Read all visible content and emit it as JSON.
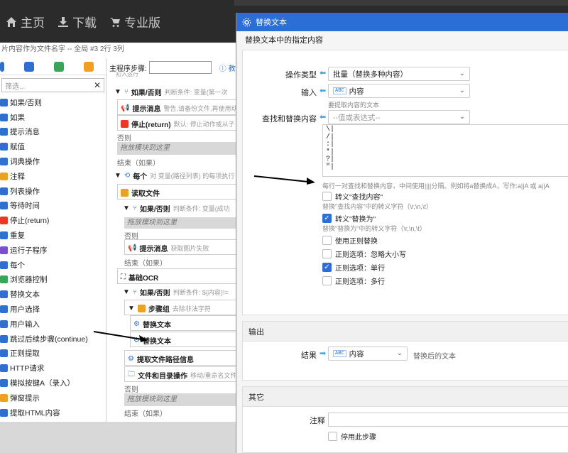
{
  "topnav": {
    "home": "主页",
    "download": "下载",
    "pro": "专业版"
  },
  "subtitle": "片内容作为文件名字 -- 全局 #3 2行 3列",
  "leftpanel": {
    "search_placeholder": "筛选...",
    "items": [
      {
        "label": "如果/否则",
        "icon": "branch-icon",
        "color": "#2f6fd0"
      },
      {
        "label": "如果",
        "icon": "branch-icon",
        "color": "#2f6fd0"
      },
      {
        "label": "提示消息",
        "icon": "megaphone-icon",
        "color": "#2f6fd0"
      },
      {
        "label": "赋值",
        "icon": "pencil-icon",
        "color": "#2f6fd0"
      },
      {
        "label": "词典操作",
        "icon": "book-icon",
        "color": "#2f6fd0"
      },
      {
        "label": "注释",
        "icon": "note-icon",
        "color": "#f0a020"
      },
      {
        "label": "列表操作",
        "icon": "list-icon",
        "color": "#2f6fd0"
      },
      {
        "label": "等待时间",
        "icon": "clock-icon",
        "color": "#2f6fd0"
      },
      {
        "label": "停止(return)",
        "icon": "stop-icon",
        "color": "#e83a1f"
      },
      {
        "label": "重复",
        "icon": "repeat-icon",
        "color": "#2f6fd0"
      },
      {
        "label": "运行子程序",
        "icon": "subroutine-icon",
        "color": "#7b4fd0"
      },
      {
        "label": "每个",
        "icon": "loop-icon",
        "color": "#2f6fd0"
      },
      {
        "label": "浏览器控制",
        "icon": "browser-icon",
        "color": "#3aa55a"
      },
      {
        "label": "替换文本",
        "icon": "gear-icon",
        "color": "#2f6fd0"
      },
      {
        "label": "用户选择",
        "icon": "user-icon",
        "color": "#2f6fd0"
      },
      {
        "label": "用户输入",
        "icon": "user-icon",
        "color": "#2f6fd0"
      },
      {
        "label": "跳过后续步骤(continue)",
        "icon": "skip-icon",
        "color": "#2f6fd0"
      },
      {
        "label": "正则提取",
        "icon": "gear-icon",
        "color": "#2f6fd0"
      },
      {
        "label": "HTTP请求",
        "icon": "gear-icon",
        "color": "#2f6fd0"
      },
      {
        "label": "模拟按键A（录入）",
        "icon": "gear-icon",
        "color": "#2f6fd0"
      },
      {
        "label": "弹窗提示",
        "icon": "popup-icon",
        "color": "#f0a020"
      },
      {
        "label": "提取HTML内容",
        "icon": "html-icon",
        "color": "#2f6fd0"
      }
    ]
  },
  "flow": {
    "main_label": "主程序步骤:",
    "help_label": "教",
    "truncated_top": "初入运行",
    "if_else_1": {
      "title": "如果/否则",
      "cond": "判断条件: 变量(第一次"
    },
    "prompt_1": {
      "title": "提示消息",
      "desc": "警告,请备份文件,再使用动作"
    },
    "stop_1": {
      "title": "停止(return)",
      "desc": "默认: 停止动作或从子"
    },
    "else_1": "否则",
    "drag_here_1": "拖放模块到这里",
    "end_1": "结束（如果）",
    "foreach": {
      "title": "每个",
      "desc": "对 变量(路径列表) 的每项执行"
    },
    "read_file": "读取文件",
    "if_else_2": {
      "title": "如果/否则",
      "cond": "判断条件: 变量(成功"
    },
    "drag_here_2": "拖放模块到这里",
    "else_2": "否则",
    "prompt_2": {
      "title": "提示消息",
      "desc": "获取图片失败"
    },
    "end_2": "结束（如果）",
    "ocr": "基础OCR",
    "if_else_3": {
      "title": "如果/否则",
      "cond": "判断条件: ${内容}!="
    },
    "step_group": {
      "title": "步骤组",
      "desc": "去除非法字符"
    },
    "replace_1": "替换文本",
    "replace_2": "替换文本",
    "extract_path": "提取文件路径信息",
    "file_op": {
      "title": "文件和目录操作",
      "desc": "移动/重命名文件"
    },
    "else_3": "否则",
    "drag_here_3": "拖放模块到这里",
    "end_3": "结束（如果）"
  },
  "dialog": {
    "title": "替换文本",
    "description": "替换文本中的指定内容",
    "op_type_label": "操作类型",
    "op_type_value": "批量（替换多种内容）",
    "input_label": "输入",
    "input_value": "内容",
    "input_hint": "要提取内容的文本",
    "find_replace_label": "查找和替换内容",
    "find_replace_placeholder": "--值或表达式--",
    "pairs_text": "\\|\n/|\n:|\n*|\n?|\n\"|",
    "pairs_hint": "每行一对查找和替换内容，中间使用||||分隔。例如将a替换成A，写作:a||A 或 a||A",
    "escape_find_label": "转义\"查找内容\"",
    "escape_find_hint": "替换\"查找内容\"中的转义字符（\\r,\\n,\\t）",
    "escape_replace_label": "转义\"替换为\"",
    "escape_replace_hint": "替换\"替换为\"中的转义字符（\\r,\\n,\\t）",
    "use_regex": "使用正则替换",
    "regex_ignore_case": "正则选项：忽略大小写",
    "regex_single_line": "正则选项：单行",
    "regex_multi_line": "正则选项：多行",
    "output_header": "输出",
    "result_label": "结果",
    "result_value": "内容",
    "result_hint": "替换后的文本",
    "other_header": "其它",
    "comment_label": "注释",
    "disable_label": "停用此步骤",
    "abc_tag": "ABC"
  }
}
